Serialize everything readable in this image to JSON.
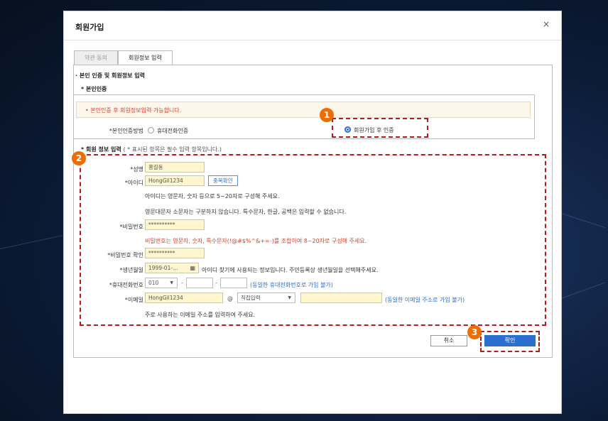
{
  "dialog": {
    "title": "회원가입",
    "close_symbol": "×"
  },
  "tabs": [
    {
      "label": "약관 동의",
      "active": false
    },
    {
      "label": "회원정보 입력",
      "active": true
    }
  ],
  "sections": {
    "main": "본인 인증 및 회원정보 입력",
    "verification": "본인인증",
    "member_info": "회원 정보 입력",
    "member_info_note": "( * 표시된 항목은 필수 입력 항목입니다.)"
  },
  "verification": {
    "notice": "본인인증 후 회원정보입력 가능합니다.",
    "method_label": "*본인인증방법",
    "options": [
      {
        "label": "휴대전화인증",
        "selected": false
      },
      {
        "label": "회원가입 후 인증",
        "selected": true
      }
    ]
  },
  "form": {
    "name": {
      "label": "*성명",
      "value": "홍길동"
    },
    "userid": {
      "label": "*아이디",
      "value": "HongGil1234",
      "check_button": "중복확인",
      "help1": "아이디는 영문자, 숫자 등으로 5~20자로 구성해 주세요.",
      "help2": "영문대문자 소문자는 구분하지 않습니다. 특수문자, 한글, 공백은 입력할 수 없습니다."
    },
    "password": {
      "label": "*비밀번호",
      "value": "**********",
      "help": "비밀번호는 영문자, 숫자, 특수문자(!@#$%^&+=-)를 조합하여 8~20자로 구성해 주세요."
    },
    "password_confirm": {
      "label": "*비밀번호 확인",
      "value": "**********"
    },
    "birth": {
      "label": "*생년월일",
      "value": "1999-01-…",
      "help": "아이디 찾기에 사용되는 정보입니다. 주민등록상 생년월일을 선택해주세요."
    },
    "phone": {
      "label": "*휴대전화번호",
      "prefix": "010",
      "sep": "-",
      "mid": "",
      "last": "",
      "hint": "(동일한 휴대전화번호로 가입 불가)"
    },
    "email": {
      "label": "*이메일",
      "local": "HongGil1234",
      "at": "@",
      "domain_select": "직접입력",
      "domain": "",
      "hint": "(동일한 이메일 주소로 가입 불가)",
      "help": "주로 사용하는 이메일 주소를 입력하여 주세요."
    }
  },
  "buttons": {
    "cancel": "취소",
    "confirm": "확인"
  },
  "badges": {
    "one": "1",
    "two": "2",
    "three": "3"
  },
  "icons": {
    "calendar": "calendar-icon",
    "dropdown": "chevron-down-icon",
    "close": "close-icon"
  },
  "colors": {
    "accent": "#2a6fd0",
    "warning_text": "#d0452e",
    "highlight_box": "#b71c1c",
    "badge": "#ef6c00",
    "field_fill": "#fdf6cf"
  }
}
